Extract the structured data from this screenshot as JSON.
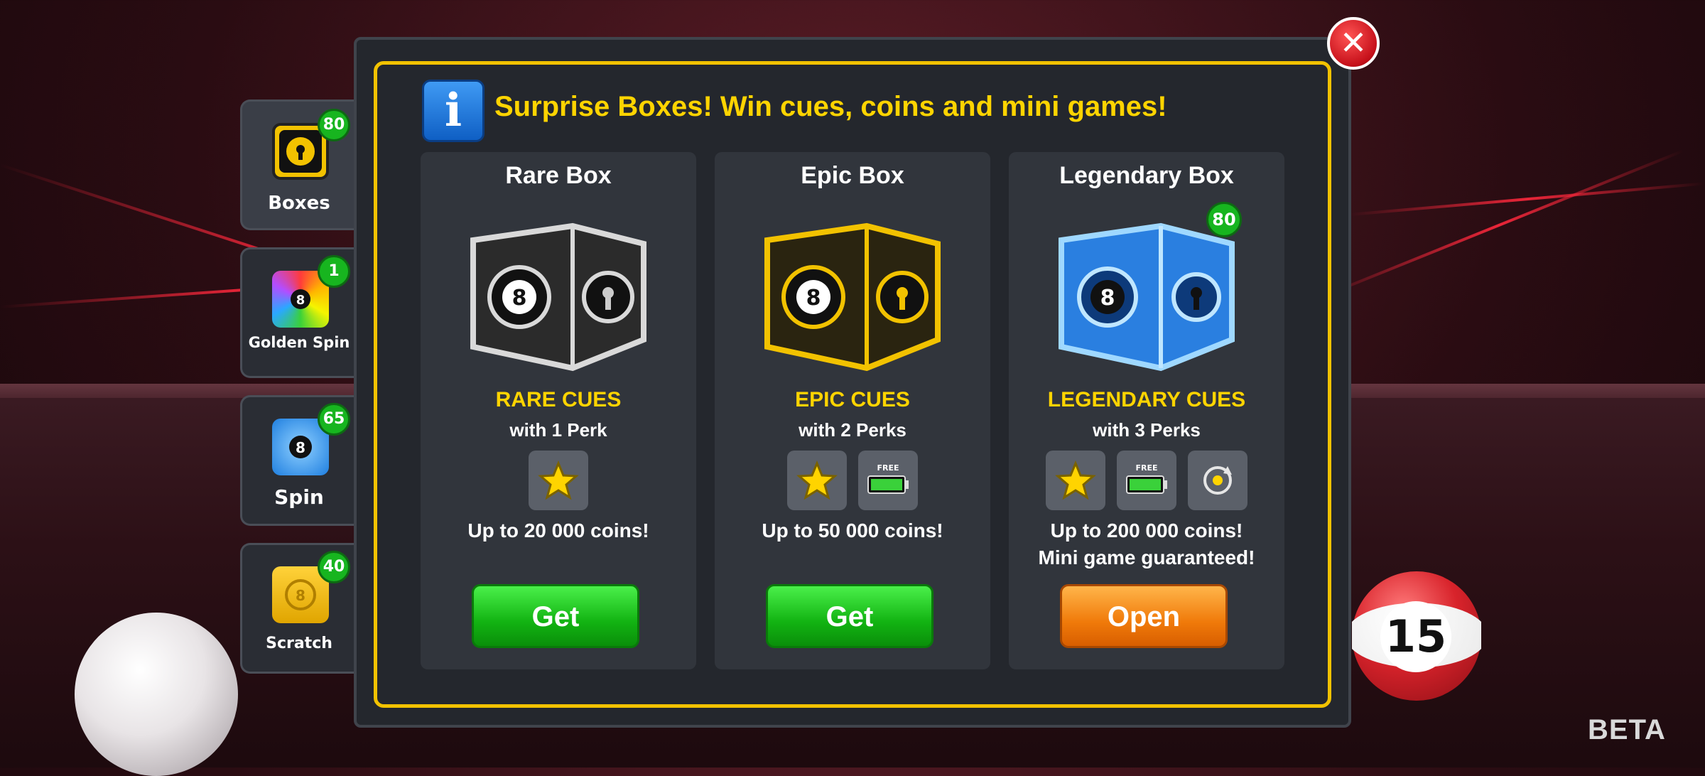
{
  "side_tabs": [
    {
      "label": "Boxes",
      "badge": "80"
    },
    {
      "label": "Golden Spin",
      "badge": "1"
    },
    {
      "label": "Spin",
      "badge": "65"
    },
    {
      "label": "Scratch",
      "badge": "40"
    }
  ],
  "dialog": {
    "headline": "Surprise Boxes! Win cues, coins and mini games!",
    "close_icon": "close-icon",
    "info_icon": "info-icon"
  },
  "boxes": [
    {
      "title": "Rare Box",
      "cues": "RARE CUES",
      "perks": "with 1 Perk",
      "coins": "Up to 20 000  coins!",
      "button": "Get"
    },
    {
      "title": "Epic Box",
      "cues": "EPIC CUES",
      "perks": "with 2 Perks",
      "coins": "Up to 50 000 coins!",
      "button": "Get"
    },
    {
      "title": "Legendary Box",
      "badge": "80",
      "cues": "LEGENDARY CUES",
      "perks": "with 3 Perks",
      "coins": "Up to 200 000 coins!",
      "coins_line2": "Mini game guaranteed!",
      "button": "Open"
    }
  ],
  "perk_labels": {
    "free": "FREE"
  },
  "background": {
    "ball_number": "15",
    "beta": "BETA"
  },
  "colors": {
    "accent_yellow": "#ffd400",
    "green_button": "#12b312",
    "orange_button": "#f07a0a",
    "badge_green": "#17b51f"
  }
}
